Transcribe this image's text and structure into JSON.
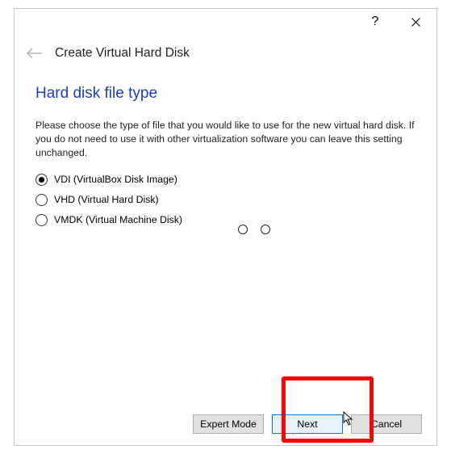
{
  "titlebar": {
    "help": "?",
    "close": "×"
  },
  "header": {
    "title": "Create Virtual Hard Disk"
  },
  "section": {
    "title": "Hard disk file type",
    "description": "Please choose the type of file that you would like to use for the new virtual hard disk. If you do not need to use it with other virtualization software you can leave this setting unchanged."
  },
  "radios": {
    "items": [
      {
        "label": "VDI (VirtualBox Disk Image)",
        "selected": true
      },
      {
        "label": "VHD (Virtual Hard Disk)",
        "selected": false
      },
      {
        "label": "VMDK (Virtual Machine Disk)",
        "selected": false
      }
    ]
  },
  "buttons": {
    "expert": "Expert Mode",
    "next": "Next",
    "cancel": "Cancel"
  }
}
